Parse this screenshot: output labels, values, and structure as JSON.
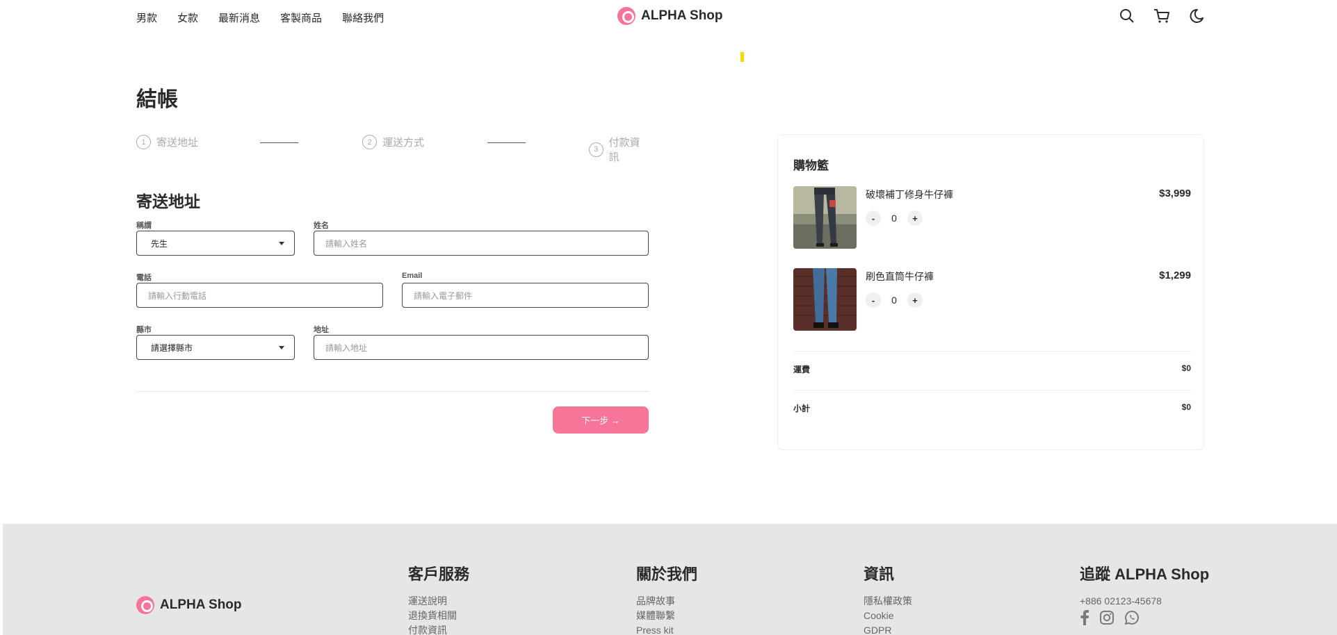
{
  "nav": {
    "items": [
      "男款",
      "女款",
      "最新消息",
      "客製商品",
      "聯絡我們"
    ]
  },
  "brand": {
    "name": "ALPHA Shop",
    "accent": "#f67599"
  },
  "header_icons": [
    "search-icon",
    "cart-icon",
    "moon-icon"
  ],
  "checkout": {
    "title": "結帳",
    "steps": [
      {
        "num": "1",
        "label": "寄送地址"
      },
      {
        "num": "2",
        "label": "運送方式"
      },
      {
        "num": "3",
        "label": "付款資訊"
      }
    ],
    "form": {
      "title": "寄送地址",
      "salutation": {
        "label": "稱謂",
        "value": "先生"
      },
      "name": {
        "label": "姓名",
        "placeholder": "請輸入姓名"
      },
      "phone": {
        "label": "電話",
        "placeholder": "請輸入行動電話"
      },
      "email": {
        "label": "Email",
        "placeholder": "請輸入電子郵件"
      },
      "city": {
        "label": "縣市",
        "value": "請選擇縣市"
      },
      "address": {
        "label": "地址",
        "placeholder": "請輸入地址"
      }
    },
    "next_button": "下一步 →"
  },
  "cart": {
    "title": "購物籃",
    "items": [
      {
        "name": "破壞補丁修身牛仔褲",
        "price": "$3,999",
        "qty": "0",
        "minus": "-",
        "plus": "+"
      },
      {
        "name": "刷色直筒牛仔褲",
        "price": "$1,299",
        "qty": "0",
        "minus": "-",
        "plus": "+"
      }
    ],
    "shipping": {
      "label": "運費",
      "value": "$0"
    },
    "subtotal": {
      "label": "小計",
      "value": "$0"
    }
  },
  "footer": {
    "columns": [
      {
        "title": "客戶服務",
        "links": [
          "運送說明",
          "退換貨相關",
          "付款資訊"
        ]
      },
      {
        "title": "關於我們",
        "links": [
          "品牌故事",
          "媒體聯繫",
          "Press kit"
        ]
      },
      {
        "title": "資訊",
        "links": [
          "隱私權政策",
          "Cookie",
          "GDPR"
        ]
      }
    ],
    "follow": {
      "title": "追蹤 ALPHA Shop",
      "phone": "+886 02123-45678",
      "icons": [
        "facebook-icon",
        "instagram-icon",
        "whatsapp-icon"
      ]
    }
  }
}
